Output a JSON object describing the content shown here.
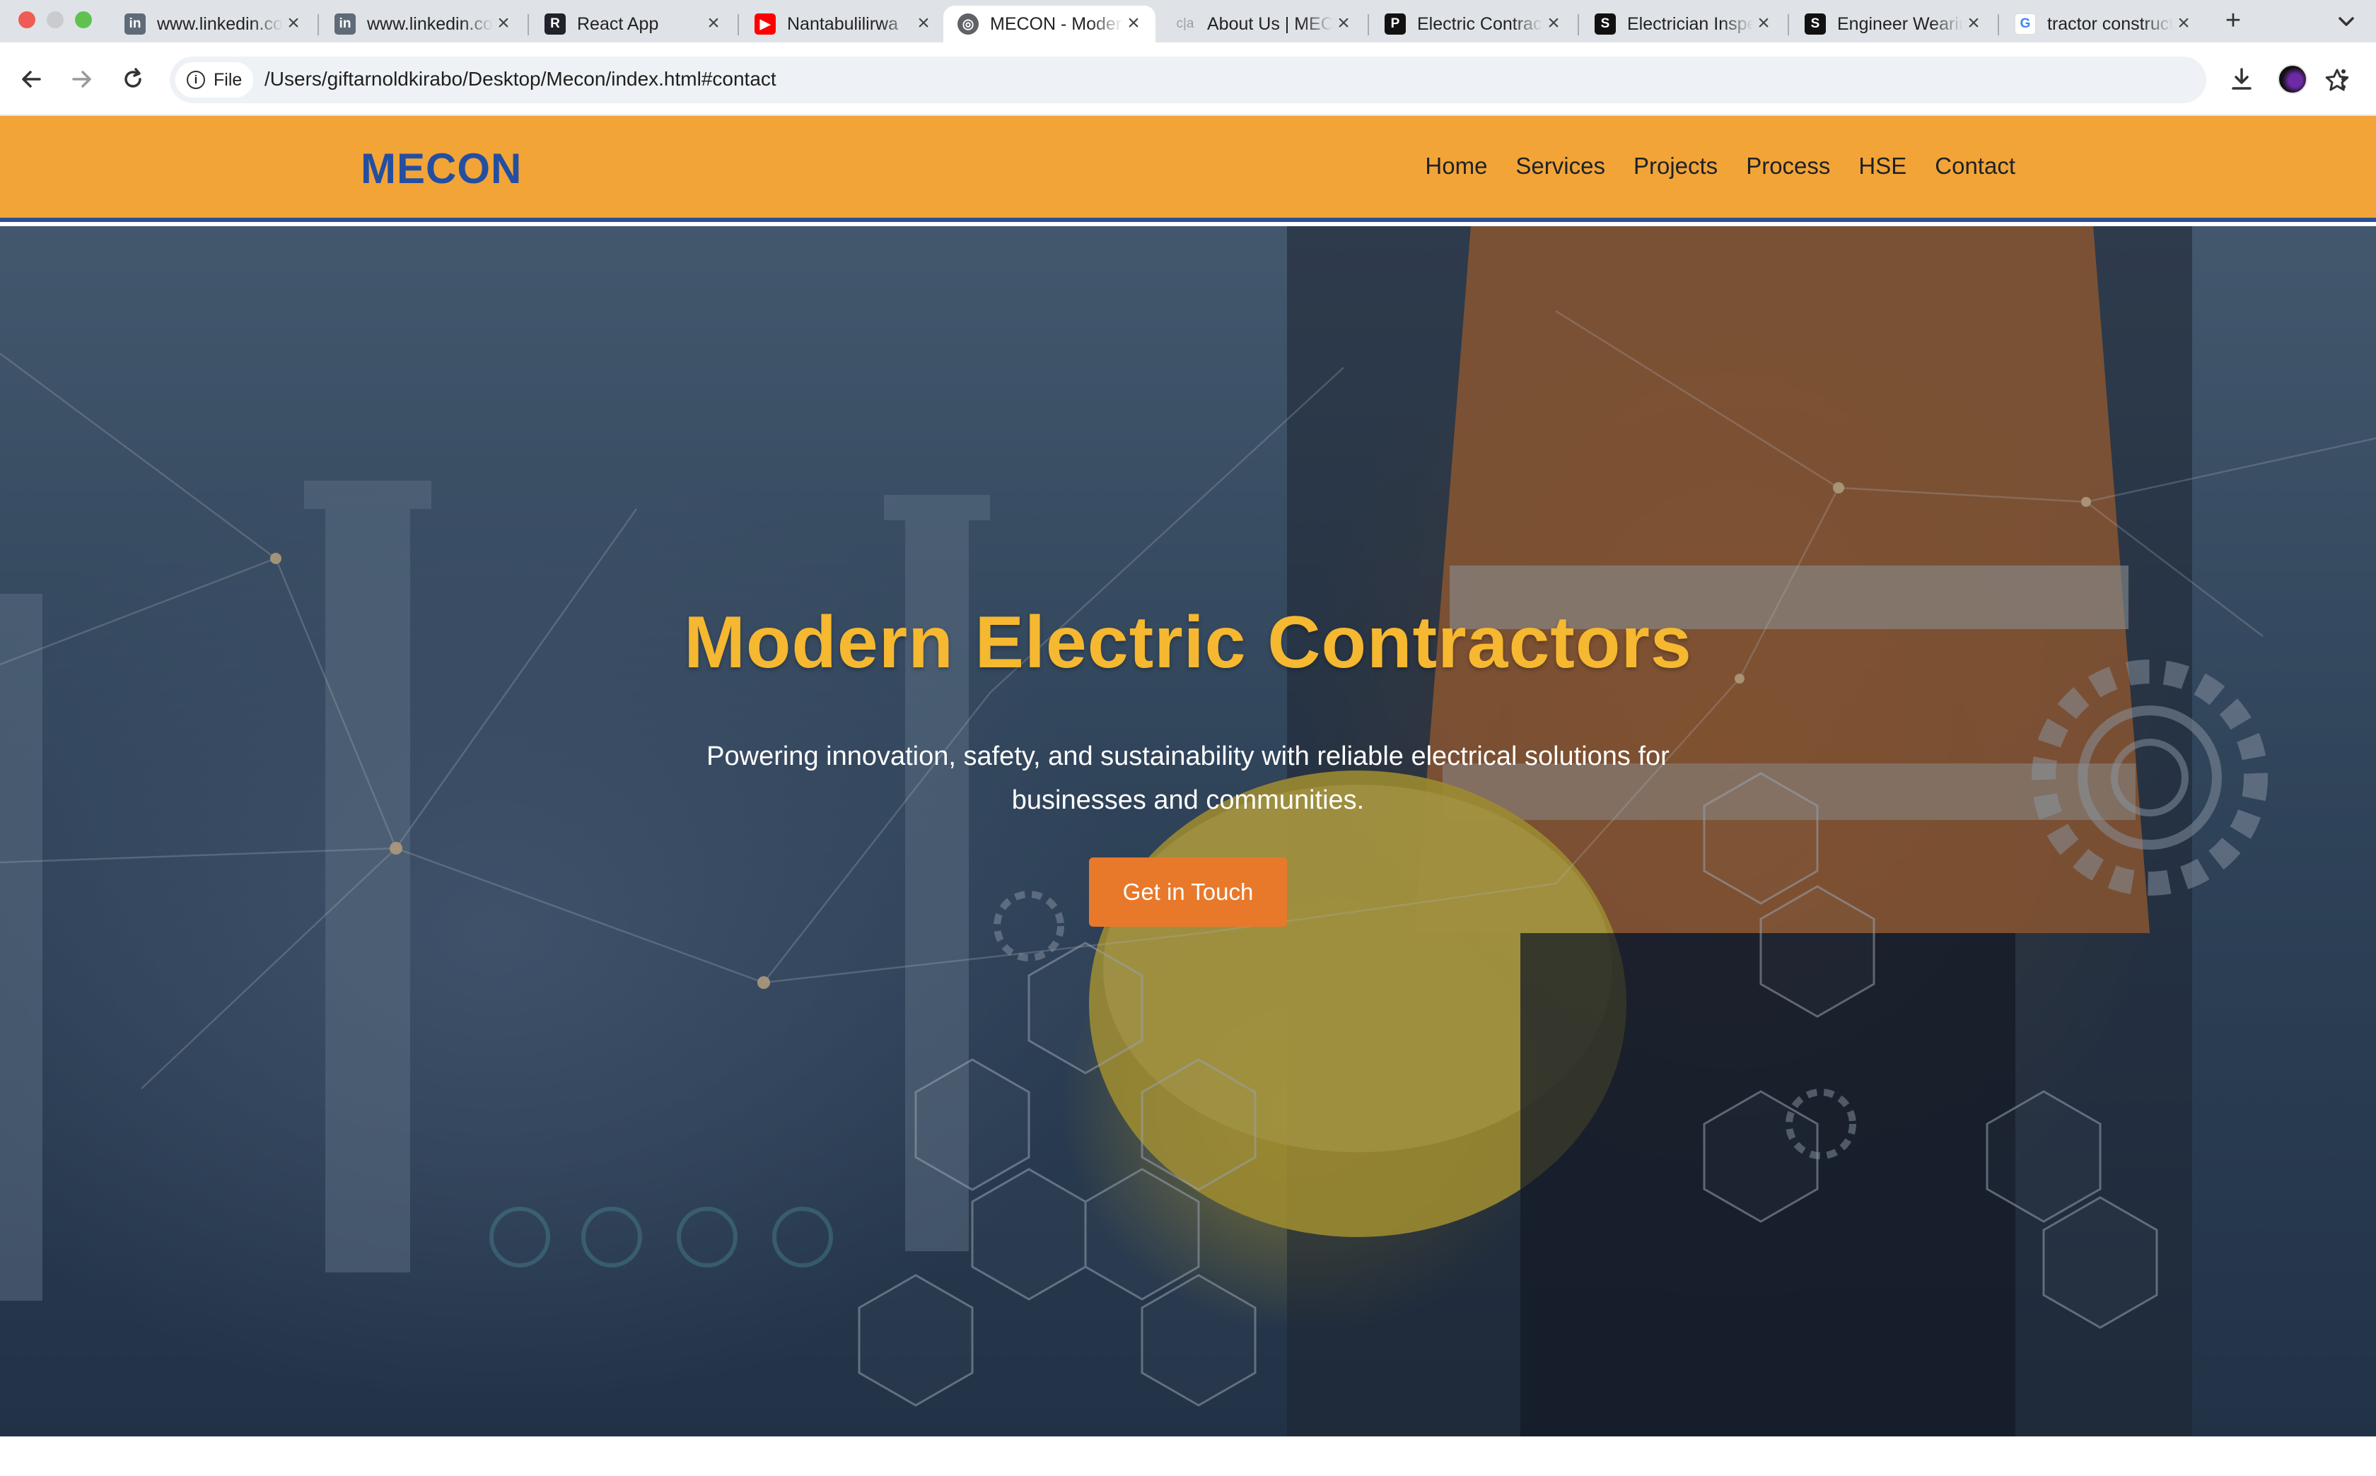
{
  "browser": {
    "tabs": [
      {
        "title": "www.linkedin.com",
        "favicon": "in",
        "color": "#5f6b78"
      },
      {
        "title": "www.linkedin.com",
        "favicon": "in",
        "color": "#5f6b78"
      },
      {
        "title": "React App",
        "favicon": "R",
        "color": "#20232a"
      },
      {
        "title": "Nantabulilirwa",
        "favicon": "▶",
        "color": "#ff0000"
      },
      {
        "title": "MECON - Modern Electric Contractors",
        "favicon": "◎",
        "color": "#5f6368"
      },
      {
        "title": "About Us | MECON",
        "favicon": "c|a",
        "color": "#9aa0a6"
      },
      {
        "title": "Electric Contractors",
        "favicon": "P",
        "color": "#111111"
      },
      {
        "title": "Electrician Inspection",
        "favicon": "S",
        "color": "#111111"
      },
      {
        "title": "Engineer Wearing",
        "favicon": "S",
        "color": "#111111"
      },
      {
        "title": "tractor construction",
        "favicon": "G",
        "color": "#ffffff"
      }
    ],
    "active_tab": 4,
    "new_tab_label": "+",
    "site_chip": "File",
    "url": "/Users/giftarnoldkirabo/Desktop/Mecon/index.html#contact"
  },
  "header": {
    "logo": "MECON",
    "nav": [
      "Home",
      "Services",
      "Projects",
      "Process",
      "HSE",
      "Contact"
    ]
  },
  "hero": {
    "title": "Modern Electric Contractors",
    "subtitle": "Powering innovation, safety, and sustainability with reliable electrical solutions for businesses and communities.",
    "cta": "Get in Touch"
  },
  "colors": {
    "header_bg": "#f2a437",
    "logo": "#244ea1",
    "hero_title": "#f5b830",
    "cta_bg": "#e8792b"
  }
}
